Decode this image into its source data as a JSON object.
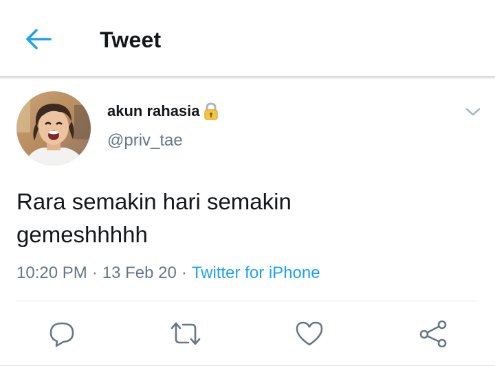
{
  "header": {
    "title": "Tweet",
    "back_icon": "arrow-left-icon",
    "accent": "#1da1f2"
  },
  "tweet": {
    "author": {
      "display_name": "akun rahasia",
      "handle": "@priv_tae",
      "lock_icon": "lock-emoji-icon",
      "avatar": "profile-photo"
    },
    "text_lines": [
      "Rara semakin hari semakin",
      "gemeshhhhh"
    ],
    "time": "10:20 PM",
    "separator": "·",
    "date": "13 Feb 20",
    "source": "Twitter for iPhone",
    "menu_icon": "chevron-down-icon"
  },
  "actions": [
    {
      "name": "reply",
      "icon": "reply-icon"
    },
    {
      "name": "retweet",
      "icon": "retweet-icon"
    },
    {
      "name": "like",
      "icon": "heart-icon"
    },
    {
      "name": "share",
      "icon": "share-icon"
    }
  ],
  "colors": {
    "text_primary": "#14171a",
    "text_secondary": "#657786",
    "link": "#1da1f2",
    "divider": "#e1e8ed"
  }
}
